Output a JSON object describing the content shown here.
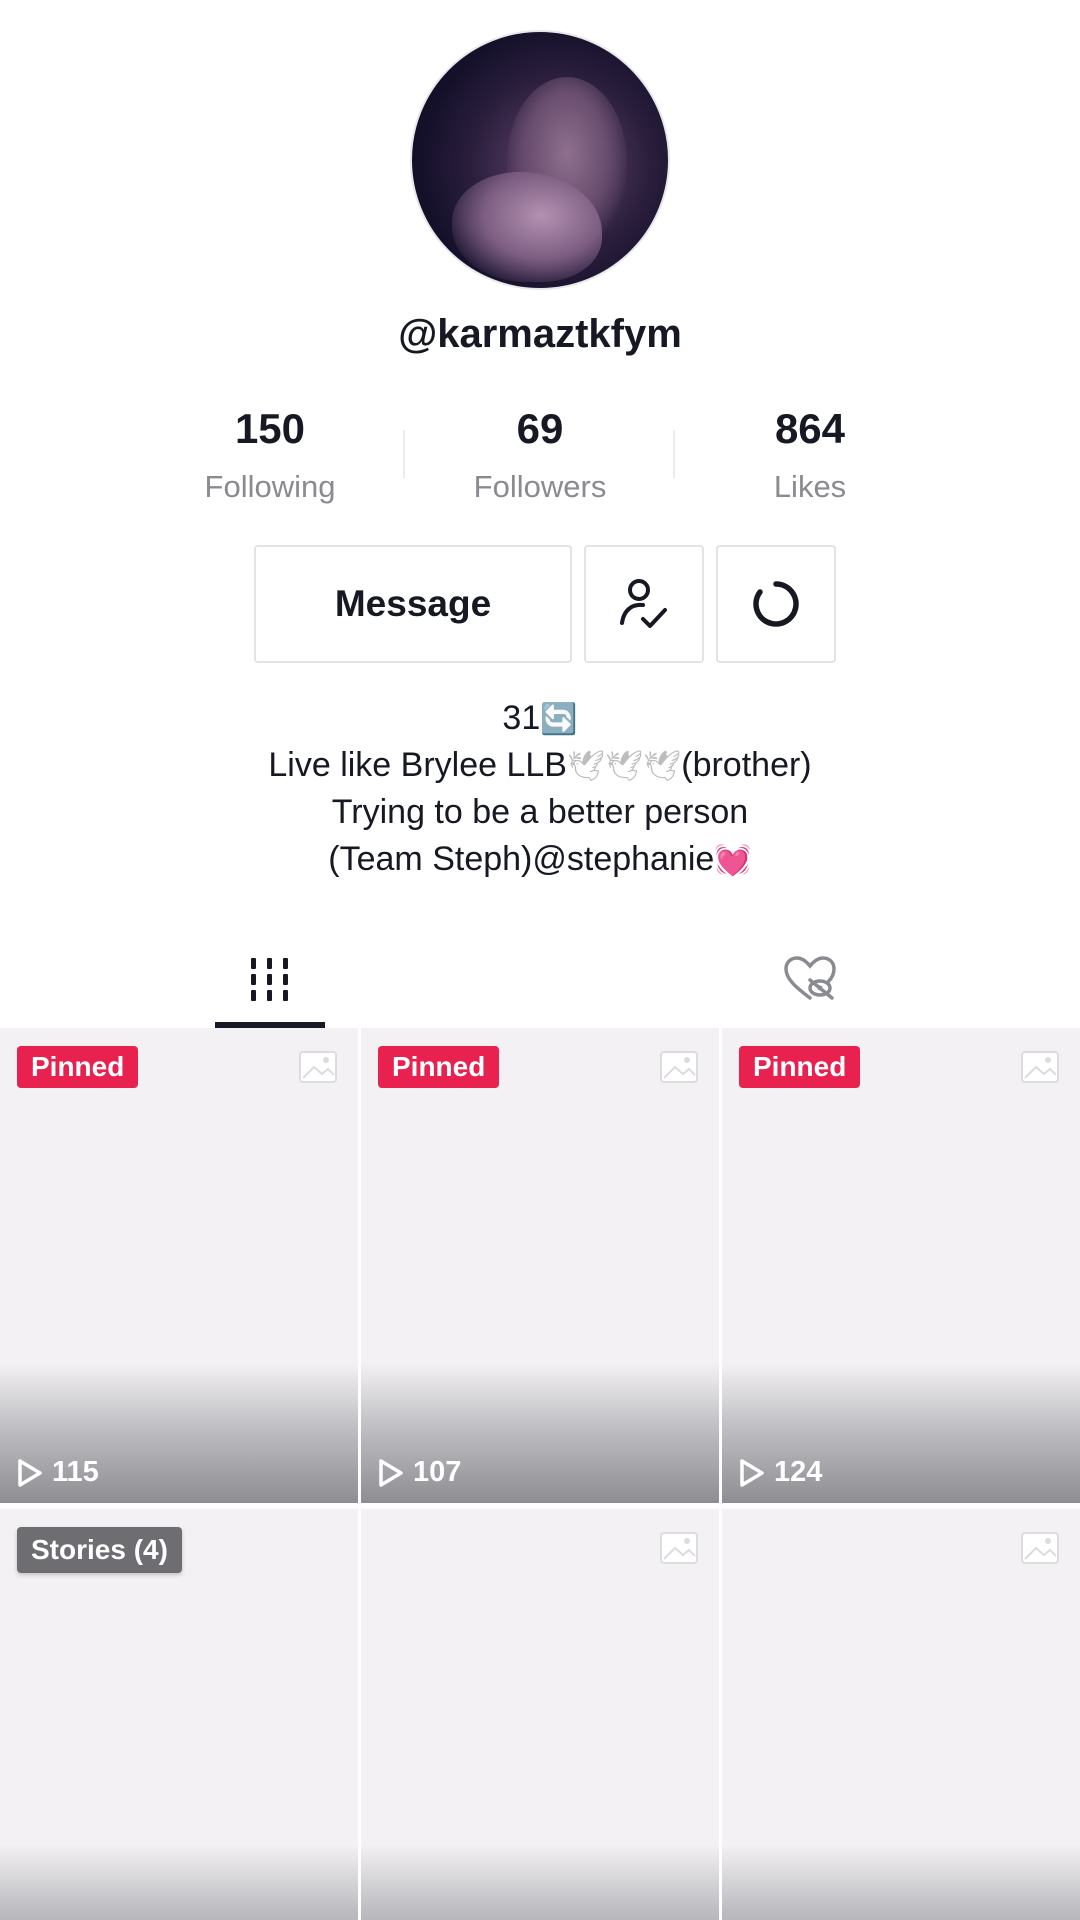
{
  "profile": {
    "username": "@karmaztkfym"
  },
  "stats": {
    "following": {
      "count": "150",
      "label": "Following"
    },
    "followers": {
      "count": "69",
      "label": "Followers"
    },
    "likes": {
      "count": "864",
      "label": "Likes"
    }
  },
  "actions": {
    "message_label": "Message",
    "follow_icon": "user-check-icon",
    "more_icon": "loading-spinner-icon"
  },
  "bio": {
    "line1_text": "31",
    "line1_emoji": "🔄",
    "line2_text": "Live like Brylee LLB",
    "line2_emoji": "🕊🕊🕊",
    "line2_suffix": "(brother)",
    "line3": "Trying to be a better person",
    "line4_text": "(Team Steph)@stephanie",
    "line4_emoji": "💓"
  },
  "tabs": {
    "videos_icon": "video-grid-icon",
    "liked_icon": "liked-hidden-icon",
    "active": "videos"
  },
  "videos": [
    {
      "badge": "Pinned",
      "plays": "115"
    },
    {
      "badge": "Pinned",
      "plays": "107"
    },
    {
      "badge": "Pinned",
      "plays": "124"
    },
    {
      "badge": "Stories (4)",
      "plays": ""
    },
    {
      "badge": "",
      "plays": ""
    },
    {
      "badge": "",
      "plays": ""
    }
  ],
  "colors": {
    "pinned_badge": "#e8214f",
    "text_primary": "#161823",
    "text_secondary": "#8a8b91"
  }
}
